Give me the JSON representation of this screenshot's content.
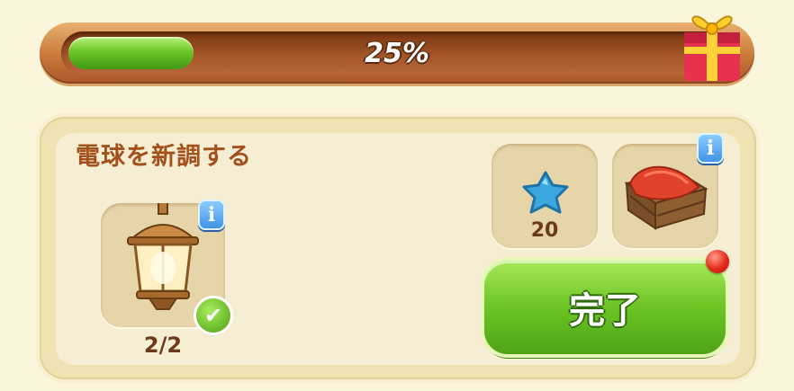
{
  "progress": {
    "value": 0.25,
    "label": "25%",
    "colors": {
      "fill": "#6fc52a",
      "frame": "#c9783a"
    },
    "reward_icon": "gift-box-icon"
  },
  "task": {
    "title": "電球を新調する",
    "item": {
      "icon": "lantern-icon",
      "info_label": "i",
      "progress_text": "2/2",
      "completed": true
    },
    "rewards": [
      {
        "icon": "blue-star-icon",
        "amount": "20"
      },
      {
        "icon": "wooden-crate-icon",
        "info_label": "i"
      }
    ],
    "complete_button": {
      "label": "完了",
      "color": "#6cc424"
    },
    "notification": true
  }
}
